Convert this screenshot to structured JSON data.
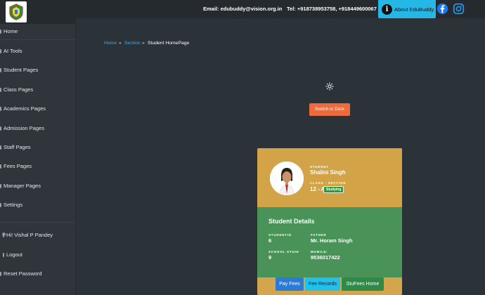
{
  "header": {
    "email": "Email: edubuddy@vision.org.in",
    "tel": "Tel: +918738953758, +918449600067",
    "about_label": "About EduBuddy"
  },
  "sidebar": {
    "items": [
      {
        "label": "Home"
      },
      {
        "label": "AI Tools"
      },
      {
        "label": "Student Pages"
      },
      {
        "label": "Class Pages"
      },
      {
        "label": "Academics Pages"
      },
      {
        "label": "Admission Pages"
      },
      {
        "label": "Staff Pages"
      },
      {
        "label": "Fees Pages"
      },
      {
        "label": "Manager Pages"
      },
      {
        "label": "Settings"
      }
    ],
    "user": "Hi! Vishal P Pandey",
    "logout": "Logout",
    "reset": "Reset Password"
  },
  "breadcrumb": {
    "home": "Home",
    "section": "Section",
    "current": "Student HomePage",
    "sep": "»"
  },
  "theme_button": "Switch to Dark",
  "student": {
    "student_label": "STUDENT",
    "name": "Shalini Singh",
    "class_label": "CLASS - SECTION",
    "class": "12 - A",
    "status": "Studying",
    "details_title": "Student Details",
    "fields": {
      "studentid_label": "STUDENTID",
      "studentid": "6",
      "father_label": "FATHER",
      "father": "Mr. Horam Singh",
      "school_label": "SCHOOL STUID",
      "school": "9",
      "mobile_label": "MOBILE:",
      "mobile": "9536017422"
    }
  },
  "actions": {
    "pay": "Pay Fees",
    "records": "Fee Records",
    "home": "StuFees Home"
  },
  "colors": {
    "accent_blue": "#25b7e6",
    "card_gold": "#d3a64d",
    "card_green": "#4a9358",
    "dark_btn": "#ed6a3c"
  }
}
